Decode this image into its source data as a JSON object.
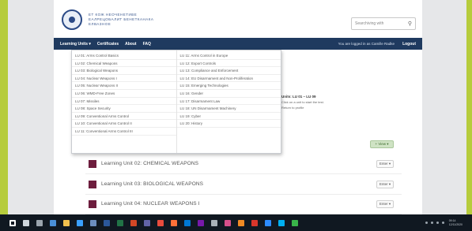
{
  "header": {
    "logo_lines": [
      "ЕТ КОЖ НЕОЧЕНЕТИВЕ",
      "ЕАЛРЕЦОБАЛИТ БЕНЕТКАНАКА",
      "ЕЛВАЗНОЕ"
    ],
    "search_placeholder": "Searchiving with"
  },
  "navbar": {
    "items": [
      "Learning Units ▾",
      "Certificates",
      "About",
      "FAQ"
    ],
    "login_text": "You are logged in as Camille Radke",
    "logout": "Logout"
  },
  "dropdown": {
    "left": [
      "LU 01: Arms Control Basics",
      "LU 02: Chemical Weapons",
      "LU 03: Biological Weapons",
      "LU 04: Nuclear Weapons I",
      "LU 05: Nuclear Weapons II",
      "LU 06: WMD-Free Zones",
      "LU 07: Missiles",
      "LU 08: Space Security",
      "LU 09: Conventional Arms Control",
      "LU 10: Conventional Arms Control II",
      "LU 11: Conventional Arms Control III"
    ],
    "right": [
      "LU 11: Arms Control in Europe",
      "LU 12: Export Controls",
      "LU 13: Compliance and Enforcement",
      "LU 14: EU Disarmament and Non-Proliferation",
      "LU 15: Emerging Technologies",
      "LU 16: Gender",
      "LU 17: Disarmament Law",
      "LU 18: UN Disarmament Machinery",
      "LU 19: Cyber",
      "LU 20: History"
    ]
  },
  "side_panel": {
    "dates": "Units: LU 01 – LU 09",
    "line1": "Click on a unit to start the test.",
    "line2": "Return to profile"
  },
  "view_button": "+ View ▾",
  "units": [
    {
      "title": "Learning Unit 02: CHEMICAL WEAPONS",
      "button": "Enter ▾"
    },
    {
      "title": "Learning Unit 03: BIOLOGICAL WEAPONS",
      "button": "Enter ▾"
    },
    {
      "title": "Learning Unit 04: NUCLEAR WEAPONS I",
      "button": "Enter ▾"
    }
  ],
  "colors": {
    "navbar": "#1f3a5f",
    "unit_swatch": "#6d1d3d",
    "background": "#b6cc3c"
  },
  "taskbar": {
    "icons": [
      "windows-icon",
      "search-icon",
      "task-view-icon",
      "edge-icon",
      "explorer-icon",
      "store-icon",
      "mail-icon",
      "word-icon",
      "excel-icon",
      "powerpoint-icon",
      "teams-icon",
      "chrome-icon",
      "firefox-icon",
      "outlook-icon",
      "onenote-icon",
      "settings-icon",
      "photos-icon",
      "vlc-icon",
      "acrobat-icon",
      "zoom-icon",
      "skype-icon",
      "paint-icon"
    ],
    "clock_time": "09:14",
    "clock_date": "12/11/2020"
  }
}
